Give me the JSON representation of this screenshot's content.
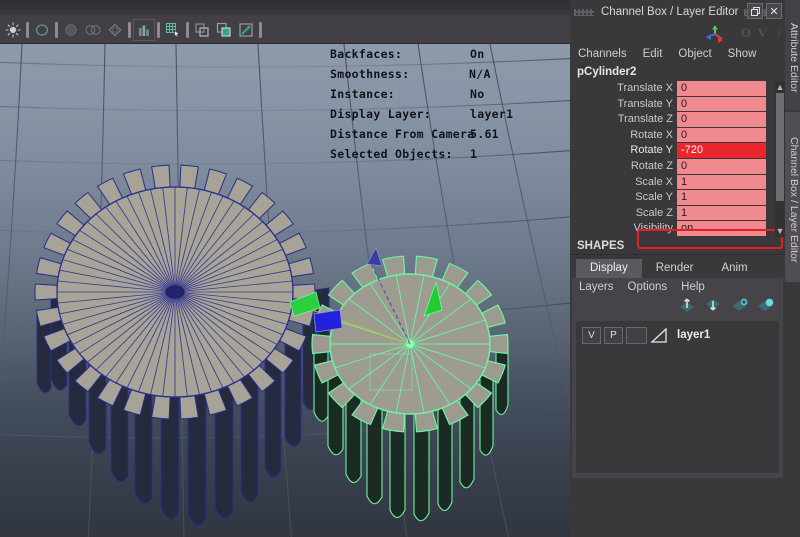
{
  "toolbar": {
    "items": [
      {
        "name": "select-tool-icon",
        "type": "select"
      },
      {
        "name": "lasso-select-icon",
        "type": "lasso"
      },
      {
        "name": "paint-select-icon",
        "type": "paint"
      },
      {
        "name": "move-tool-icon",
        "type": "move"
      },
      {
        "name": "rotate-tool-icon",
        "type": "rotate"
      },
      {
        "name": "scale-tool-icon",
        "type": "scale"
      },
      {
        "name": "soft-select-icon",
        "type": "soft",
        "framed": true
      },
      {
        "name": "snap-to-grid-icon",
        "type": "snapgrid"
      },
      {
        "name": "snap-to-curve-icon",
        "type": "snapcurve"
      },
      {
        "name": "snap-to-point-icon",
        "type": "snappoint"
      },
      {
        "name": "snap-to-view-plane-icon",
        "type": "snapview"
      }
    ]
  },
  "viewport": {
    "hud": [
      {
        "label": "Backfaces:",
        "value": "On",
        "vx": 140
      },
      {
        "label": "Smoothness:",
        "value": "N/A",
        "vx": 139
      },
      {
        "label": "Instance:",
        "value": "No",
        "vx": 140
      },
      {
        "label": "Display Layer:",
        "value": "layer1",
        "vx": 140
      },
      {
        "label": "Distance From Camera",
        "value": "5.61",
        "vx": 140
      },
      {
        "label": "Selected Objects:",
        "value": "1",
        "vx": 140
      }
    ],
    "objects": [
      {
        "name": "gear-large-unselected",
        "selected": false,
        "teeth": 30
      },
      {
        "name": "gear-small-selected",
        "selected": true,
        "teeth": 18
      }
    ],
    "selection_color": "#6cf3a2",
    "wireframe_color": "#2a2e8c",
    "manipulator": {
      "name": "rotate-manipulator",
      "axis_colors": [
        "#22cc33",
        "#2222dd",
        "#ddcc22"
      ]
    }
  },
  "panel": {
    "title": "Channel Box / Layer Editor",
    "window_buttons": [
      {
        "name": "undock-button",
        "glyph": "❐"
      },
      {
        "name": "close-button",
        "glyph": "✕"
      }
    ],
    "channel_box": {
      "menus": [
        "Channels",
        "Edit",
        "Object",
        "Show"
      ],
      "object_name": "pCylinder2",
      "shapes_label": "SHAPES",
      "attributes": [
        {
          "label": "Translate X",
          "value": "0",
          "highlight": false
        },
        {
          "label": "Translate Y",
          "value": "0",
          "highlight": false
        },
        {
          "label": "Translate Z",
          "value": "0",
          "highlight": false
        },
        {
          "label": "Rotate X",
          "value": "0",
          "highlight": false
        },
        {
          "label": "Rotate Y",
          "value": "-720",
          "highlight": true
        },
        {
          "label": "Rotate Z",
          "value": "0",
          "highlight": false
        },
        {
          "label": "Scale X",
          "value": "1",
          "highlight": false
        },
        {
          "label": "Scale Y",
          "value": "1",
          "highlight": false
        },
        {
          "label": "Scale Z",
          "value": "1",
          "highlight": false
        },
        {
          "label": "Visibility",
          "value": "on",
          "highlight": false
        }
      ],
      "field_color": "#f08a8e",
      "highlight_field_color": "#e8262c",
      "annotation_color": "#e81d23"
    },
    "layer_editor": {
      "tabs": [
        {
          "label": "Display",
          "active": true
        },
        {
          "label": "Render",
          "active": false
        },
        {
          "label": "Anim",
          "active": false
        }
      ],
      "menus": [
        "Layers",
        "Options",
        "Help"
      ],
      "toolbar_icons": [
        {
          "name": "move-layer-up-icon"
        },
        {
          "name": "move-layer-down-icon"
        },
        {
          "name": "create-new-layer-icon"
        },
        {
          "name": "create-layer-from-selected-icon"
        }
      ],
      "layers": [
        {
          "visibility": "V",
          "playback": "P",
          "shading": "",
          "name": "layer1"
        }
      ]
    }
  },
  "vertical_tabs": [
    {
      "label": "Attribute Editor",
      "active": false
    },
    {
      "label": "Channel Box / Layer Editor",
      "active": true
    }
  ]
}
